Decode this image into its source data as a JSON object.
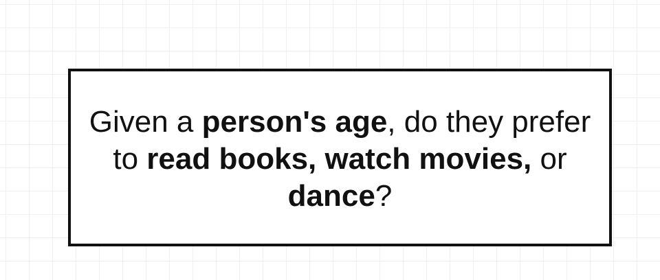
{
  "question": {
    "segments": [
      {
        "text": "Given a ",
        "bold": false
      },
      {
        "text": "person's age",
        "bold": true
      },
      {
        "text": ", do they prefer",
        "bold": false
      },
      {
        "break": true
      },
      {
        "text": "to ",
        "bold": false
      },
      {
        "text": "read books, watch movies,",
        "bold": true
      },
      {
        "text": " or",
        "bold": false
      },
      {
        "break": true
      },
      {
        "text": "dance",
        "bold": true
      },
      {
        "text": "?",
        "bold": false
      }
    ]
  }
}
